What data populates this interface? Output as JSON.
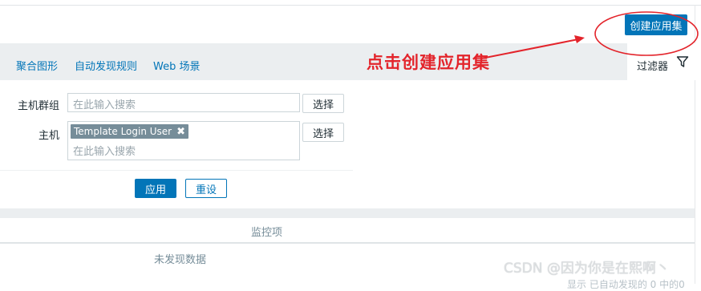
{
  "header": {
    "create_button": "创建应用集"
  },
  "tabs": [
    {
      "label": "聚合图形"
    },
    {
      "label": "自动发现规则"
    },
    {
      "label": "Web 场景"
    }
  ],
  "filter": {
    "tab_label": "过滤器",
    "icon": "filter-icon"
  },
  "annotation": {
    "text": "点击创建应用集",
    "color": "#e3242b"
  },
  "form": {
    "host_group": {
      "label": "主机群组",
      "placeholder": "在此输入搜索",
      "select_label": "选择"
    },
    "host": {
      "label": "主机",
      "chip": "Template Login User",
      "placeholder": "在此输入搜索",
      "select_label": "选择"
    },
    "apply_label": "应用",
    "reset_label": "重设"
  },
  "table": {
    "columns": [
      "监控项"
    ],
    "empty_text": "未发现数据",
    "footer_partial": "显示 已自动发现的 0 中的0"
  },
  "watermark": "CSDN @因为你是在熙啊丶",
  "colors": {
    "accent": "#0275b8",
    "annotation": "#e3242b",
    "muted": "#768d99"
  }
}
